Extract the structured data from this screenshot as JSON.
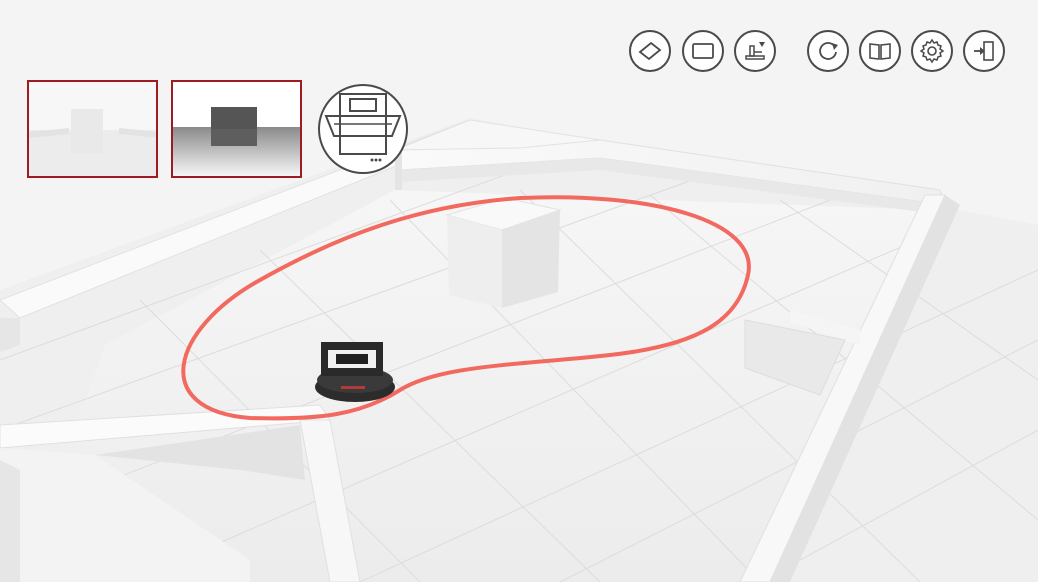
{
  "app": {
    "background": "#f2f2f2",
    "accent": "#9e1b22",
    "path_color": "#f26a5f",
    "icon_color": "#4a4a4a"
  },
  "toolbar": {
    "left_group": [
      {
        "name": "floor-plane-icon",
        "action": "floor"
      },
      {
        "name": "rectangle-icon",
        "action": "wall"
      },
      {
        "name": "mapping-robot-icon",
        "action": "mapping"
      }
    ],
    "right_group": [
      {
        "name": "rotate-icon",
        "action": "reset"
      },
      {
        "name": "book-icon",
        "action": "manual"
      },
      {
        "name": "gear-icon",
        "action": "settings"
      },
      {
        "name": "exit-icon",
        "action": "exit"
      }
    ]
  },
  "camera_previews": [
    {
      "name": "rgb-camera-preview",
      "kind": "rgb"
    },
    {
      "name": "depth-camera-preview",
      "kind": "depth"
    }
  ],
  "robot_badge": {
    "name": "robot-model-icon"
  }
}
